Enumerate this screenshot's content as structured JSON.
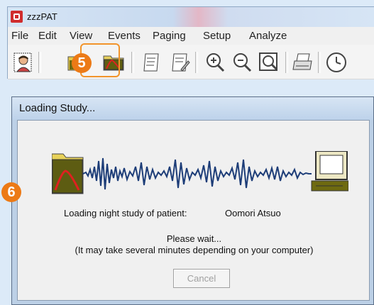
{
  "app": {
    "title": "zzzPAT",
    "menu": [
      "File",
      "Edit",
      "View",
      "Events",
      "Paging",
      "Setup",
      "Analyze"
    ]
  },
  "toolbar": {
    "icons": [
      "patient-icon",
      "open-study-icon",
      "report-icon",
      "report-edit-icon",
      "zoom-in-icon",
      "zoom-out-icon",
      "zoom-fit-icon",
      "print-icon",
      "clock-icon"
    ]
  },
  "callouts": {
    "step5": "5",
    "step6": "6"
  },
  "dialog": {
    "title": "Loading Study...",
    "loading_label": "Loading night study of patient:",
    "patient_name": "Oomori Atsuo",
    "wait_line1": "Please wait...",
    "wait_line2": "(It may take several minutes depending on your computer)",
    "cancel_label": "Cancel"
  },
  "colors": {
    "accent": "#ec7a16",
    "waveform": "#1d3d78",
    "folder": "#e8d25a"
  }
}
